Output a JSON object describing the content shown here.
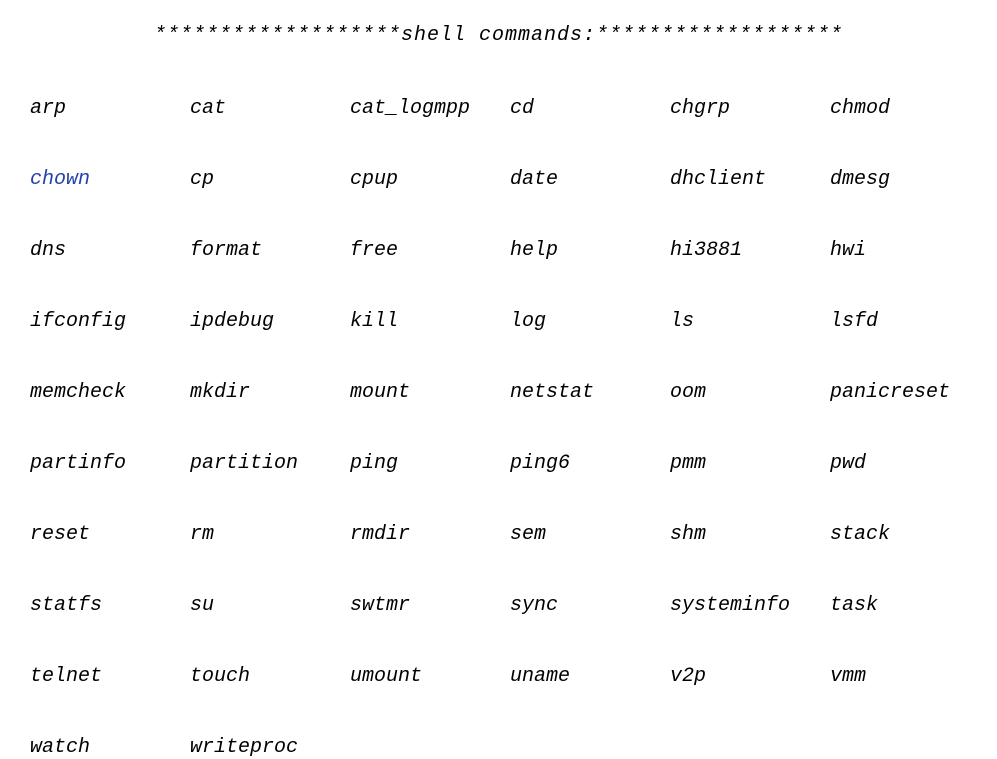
{
  "header": {
    "prefix": "*******************",
    "title": "shell commands:",
    "suffix": "*******************"
  },
  "commands": [
    [
      "arp",
      "cat",
      "cat_logmpp",
      "cd",
      "chgrp",
      "chmod"
    ],
    [
      "chown",
      "cp",
      "cpup",
      "date",
      "dhclient",
      "dmesg"
    ],
    [
      "dns",
      "format",
      "free",
      "help",
      "hi3881",
      "hwi"
    ],
    [
      "ifconfig",
      "ipdebug",
      "kill",
      "log",
      "ls",
      "lsfd"
    ],
    [
      "memcheck",
      "mkdir",
      "mount",
      "netstat",
      "oom",
      "panicreset"
    ],
    [
      "partinfo",
      "partition",
      "ping",
      "ping6",
      "pmm",
      "pwd"
    ],
    [
      "reset",
      "rm",
      "rmdir",
      "sem",
      "shm",
      "stack"
    ],
    [
      "statfs",
      "su",
      "swtmr",
      "sync",
      "systeminfo",
      "task"
    ],
    [
      "telnet",
      "touch",
      "umount",
      "uname",
      "v2p",
      "vmm"
    ],
    [
      "watch",
      "writeproc"
    ]
  ],
  "highlighted": "chown"
}
